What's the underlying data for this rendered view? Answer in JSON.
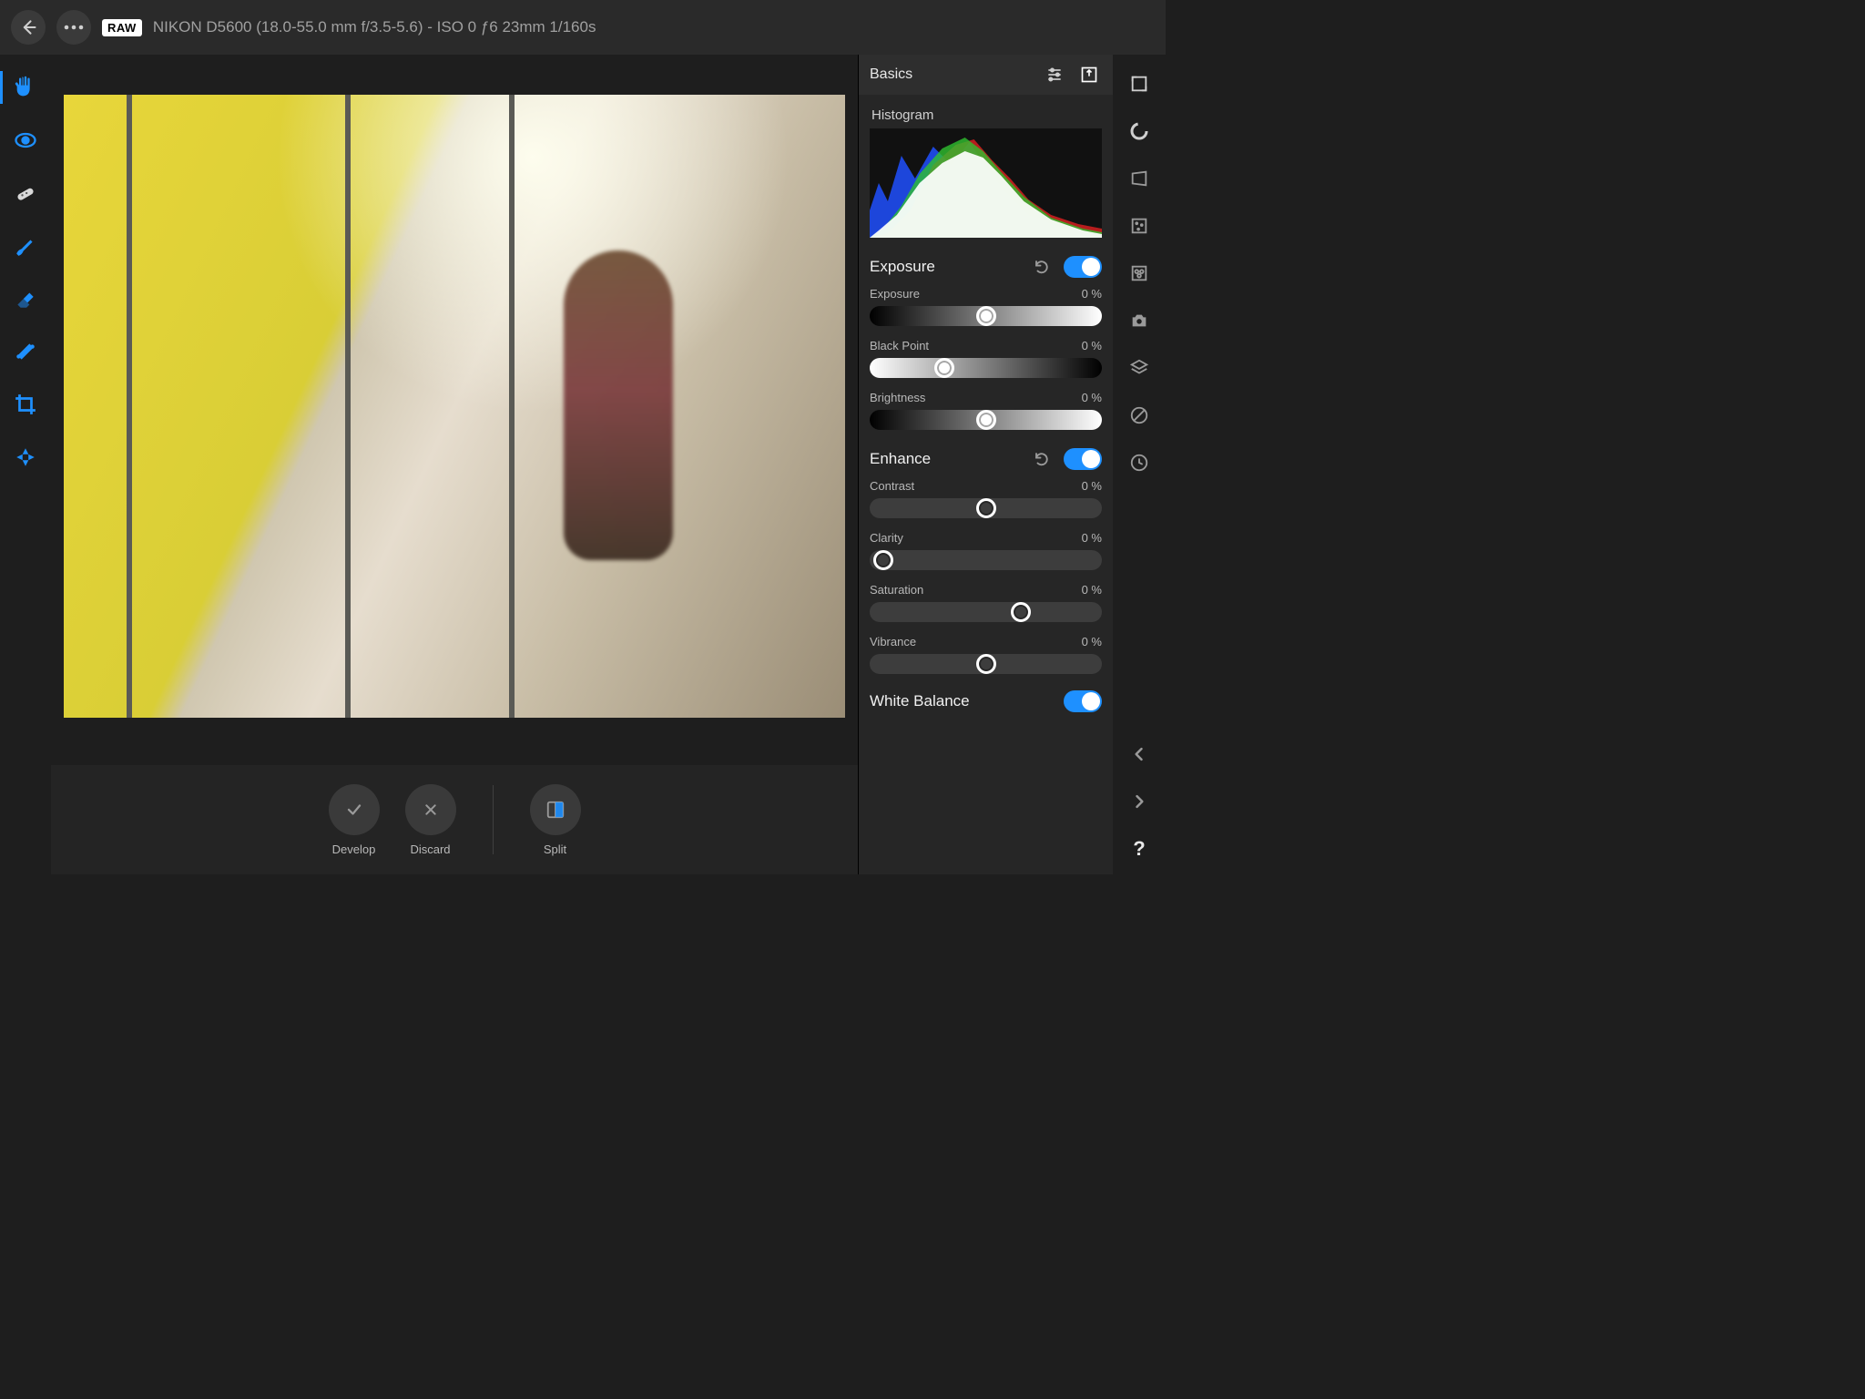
{
  "header": {
    "raw_badge": "RAW",
    "meta": "NIKON D5600 (18.0-55.0 mm f/3.5-5.6) - ISO 0 ƒ6 23mm 1/160s"
  },
  "inspector": {
    "title": "Basics",
    "histogram_label": "Histogram",
    "sections": {
      "exposure": {
        "title": "Exposure",
        "sliders": {
          "exposure": {
            "label": "Exposure",
            "value": "0 %"
          },
          "black_point": {
            "label": "Black Point",
            "value": "0 %"
          },
          "brightness": {
            "label": "Brightness",
            "value": "0 %"
          }
        }
      },
      "enhance": {
        "title": "Enhance",
        "sliders": {
          "contrast": {
            "label": "Contrast",
            "value": "0 %"
          },
          "clarity": {
            "label": "Clarity",
            "value": "0 %"
          },
          "saturation": {
            "label": "Saturation",
            "value": "0 %"
          },
          "vibrance": {
            "label": "Vibrance",
            "value": "0 %"
          }
        }
      },
      "white_balance": {
        "title": "White Balance"
      }
    }
  },
  "actions": {
    "develop": "Develop",
    "discard": "Discard",
    "split": "Split"
  }
}
